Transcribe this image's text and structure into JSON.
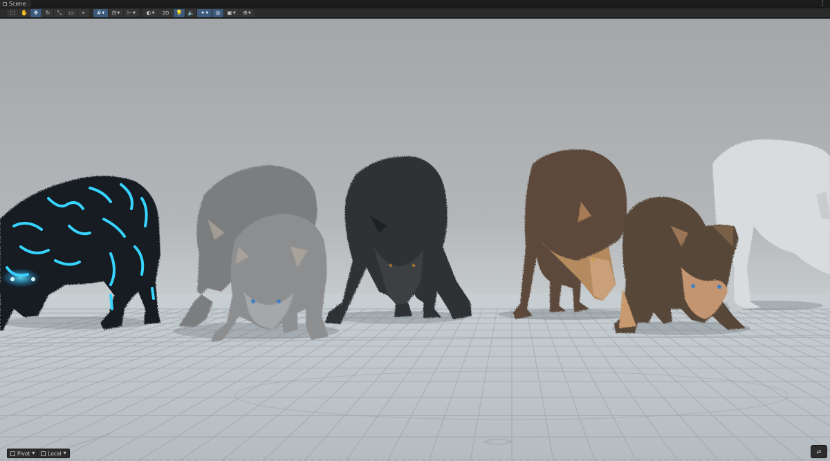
{
  "window": {
    "tab_title": "Scene",
    "menu_icon": "kebab-menu-icon"
  },
  "toolbar": {
    "tools": [
      {
        "icon": "view-tool-icon",
        "glyph": "⬚"
      },
      {
        "icon": "hand-tool-icon",
        "glyph": "✋"
      },
      {
        "icon": "move-tool-icon",
        "glyph": "✥"
      },
      {
        "icon": "rotate-tool-icon",
        "glyph": "↻"
      },
      {
        "icon": "scale-tool-icon",
        "glyph": "⤡"
      },
      {
        "icon": "rect-tool-icon",
        "glyph": "▭"
      },
      {
        "icon": "transform-tool-icon",
        "glyph": "⌖"
      }
    ],
    "mode_2d_label": "2D",
    "active_tool": "move-tool-icon"
  },
  "bottom_bar": {
    "pivot_label": "Pivot",
    "local_label": "Local"
  },
  "colors": {
    "background_top": "#a3a6a8",
    "floor": "#c6cdd2",
    "grid": "#8d969c",
    "glow": "#22c8ff",
    "accent": "#3d5a7a"
  },
  "scene": {
    "objects": [
      {
        "name": "Glowing rune wolf",
        "fur": "#151a20"
      },
      {
        "name": "Grey wolf",
        "fur": "#7a7c7e"
      },
      {
        "name": "Grey wolf pup",
        "fur": "#8a8c8e"
      },
      {
        "name": "Black wolf",
        "fur": "#2d3033"
      },
      {
        "name": "Brown wolf",
        "fur": "#5a4a3c"
      },
      {
        "name": "Brown wolf pup",
        "fur": "#58473a"
      },
      {
        "name": "White wolf",
        "fur": "#d8dbdd"
      }
    ]
  }
}
